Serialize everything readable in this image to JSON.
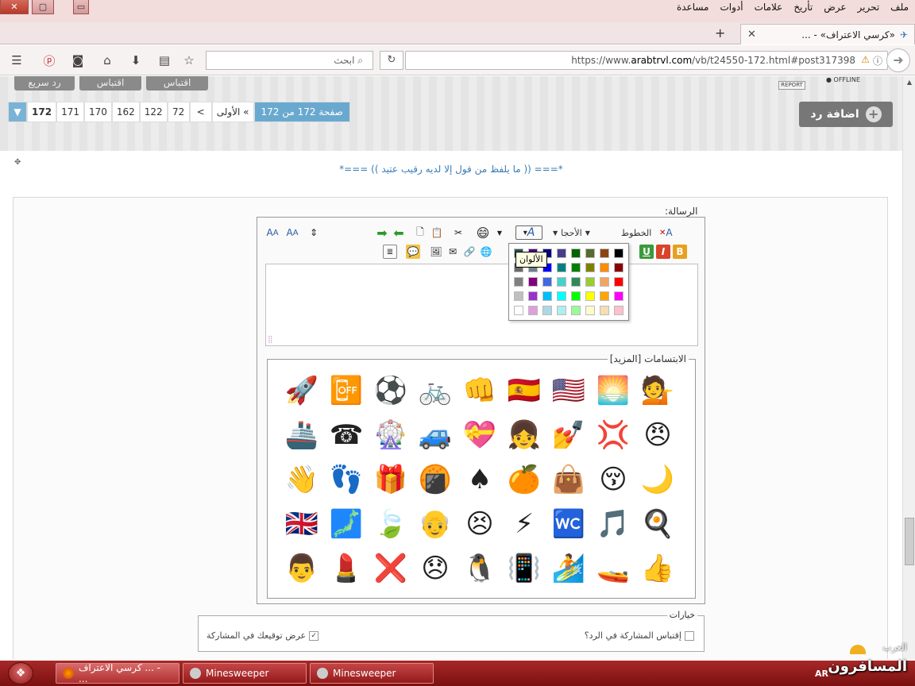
{
  "window": {
    "close": "✕",
    "maximize": "▢",
    "minimize": "▭"
  },
  "menu": [
    "ملف",
    "تحرير",
    "عرض",
    "تأريخ",
    "علامات",
    "أدوات",
    "مساعدة"
  ],
  "tab": {
    "title": "«كرسي الاعتراف» - ...",
    "new_tab": "+",
    "close": "✕"
  },
  "nav": {
    "url_prefix": "https://www.",
    "url_domain": "arabtrvl.com",
    "url_rest": "/vb/t24550-172.html#post317398",
    "search_placeholder": "ابحث",
    "back": "➜",
    "reload": "↻"
  },
  "page": {
    "top_buttons": [
      "اقتباس",
      "اقتباس",
      "رد سريع"
    ],
    "report": "REPORT",
    "offline": "● OFFLINE",
    "pager": {
      "current": "172",
      "pages": [
        "171",
        "170",
        "162",
        "122",
        "72"
      ],
      "prev": "<",
      "first": "الأولى",
      "first_arrow": "«",
      "info": "صفحة 172 من 172"
    },
    "add_reply": "اضافة رد",
    "add_reply_plus": "+",
    "quote_text": "*=== (( ما يلفظ من قول إلا لديه رقيب عتيد )) ===*"
  },
  "editor": {
    "message_label": "الرسالة:",
    "fonts_label": "الخطوط",
    "sizes_label": "الأحجا",
    "colors_tooltip": "الألوان",
    "smilies_legend": "الابتسامات [المزيد]",
    "options_legend": "خيارات",
    "option_signature": "عرض توقيعك في المشاركة",
    "option_quote": "إقتباس المشاركة في الرد؟",
    "colors": [
      "#000000",
      "#8b4513",
      "#556b2f",
      "#006400",
      "#483d8b",
      "#000080",
      "#4b0082",
      "#2f4f4f",
      "#8b0000",
      "#ff8c00",
      "#808000",
      "#008000",
      "#008080",
      "#0000ff",
      "#708090",
      "#696969",
      "#ff0000",
      "#f4a460",
      "#9acd32",
      "#2e8b57",
      "#48d1cc",
      "#4169e1",
      "#800080",
      "#808080",
      "#ff00ff",
      "#ffa500",
      "#ffff00",
      "#00ff00",
      "#00ffff",
      "#00bfff",
      "#9932cc",
      "#c0c0c0",
      "#ffc0cb",
      "#f5deb3",
      "#fffacd",
      "#98fb98",
      "#afeeee",
      "#add8e6",
      "#dda0dd",
      "#ffffff"
    ],
    "emojis": [
      "💁",
      "🌅",
      "🇺🇸",
      "🇪🇸",
      "👊",
      "🚲",
      "⚽",
      "📴",
      "🚀",
      "😠",
      "💢",
      "💅",
      "👧",
      "💝",
      "🚙",
      "🎡",
      "☎",
      "🚢",
      "🌙",
      "😚",
      "👜",
      "🍊",
      "♠",
      "🍘",
      "🎁",
      "👣",
      "👋",
      "🍳",
      "🎵",
      "🚾",
      "⚡",
      "😣",
      "👴",
      "🍃",
      "🗾",
      "🇬🇧",
      "👍",
      "🚤",
      "🏄",
      "📳",
      "🐧",
      "😞",
      "❌",
      "💄",
      "👨"
    ]
  },
  "taskbar": {
    "start": "❖",
    "tasks": [
      "كرسي الاعتراف ... - ...",
      "Minesweeper",
      "Minesweeper"
    ],
    "lang": "AR",
    "watermark_top": "العرب",
    "watermark_main": "المسافرون"
  }
}
